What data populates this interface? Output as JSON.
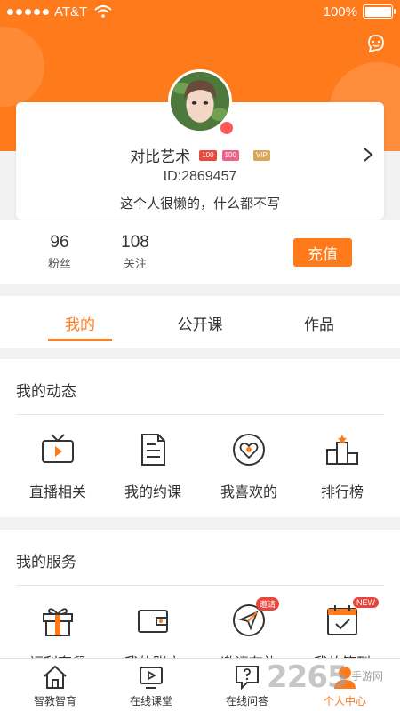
{
  "status_bar": {
    "carrier": "AT&T",
    "battery": "100%",
    "battery_level": 1.0
  },
  "profile": {
    "username": "对比艺术",
    "badges": [
      "100",
      "100",
      "VIP"
    ],
    "user_id": "ID:2869457",
    "bio": "这个人很懒的，什么都不写"
  },
  "stats": [
    {
      "value": "96",
      "label": "粉丝"
    },
    {
      "value": "108",
      "label": "关注"
    }
  ],
  "recharge_label": "充值",
  "tabs": [
    {
      "label": "我的",
      "active": true
    },
    {
      "label": "公开课",
      "active": false
    },
    {
      "label": "作品",
      "active": false
    }
  ],
  "dynamics": {
    "title": "我的动态",
    "items": [
      {
        "label": "直播相关",
        "icon": "tv-icon"
      },
      {
        "label": "我的约课",
        "icon": "document-icon"
      },
      {
        "label": "我喜欢的",
        "icon": "heart-icon"
      },
      {
        "label": "排行榜",
        "icon": "podium-icon"
      }
    ]
  },
  "services": {
    "title": "我的服务",
    "items": [
      {
        "label": "福利套餐",
        "icon": "gift-icon",
        "tag": ""
      },
      {
        "label": "我的账户",
        "icon": "wallet-icon",
        "tag": ""
      },
      {
        "label": "邀请有礼",
        "icon": "send-icon",
        "tag": "邀请"
      },
      {
        "label": "我的签到",
        "icon": "calendar-icon",
        "tag": "NEW"
      }
    ]
  },
  "bottom_nav": [
    {
      "label": "智教智育",
      "icon": "home-icon",
      "active": false
    },
    {
      "label": "在线课堂",
      "icon": "video-icon",
      "active": false
    },
    {
      "label": "在线问答",
      "icon": "question-icon",
      "active": false
    },
    {
      "label": "个人中心",
      "icon": "user-icon",
      "active": true
    }
  ],
  "watermark": {
    "main": "2265",
    "sub": "手游网"
  },
  "colors": {
    "accent": "#ff7a1a",
    "background": "#f2f2f2"
  }
}
